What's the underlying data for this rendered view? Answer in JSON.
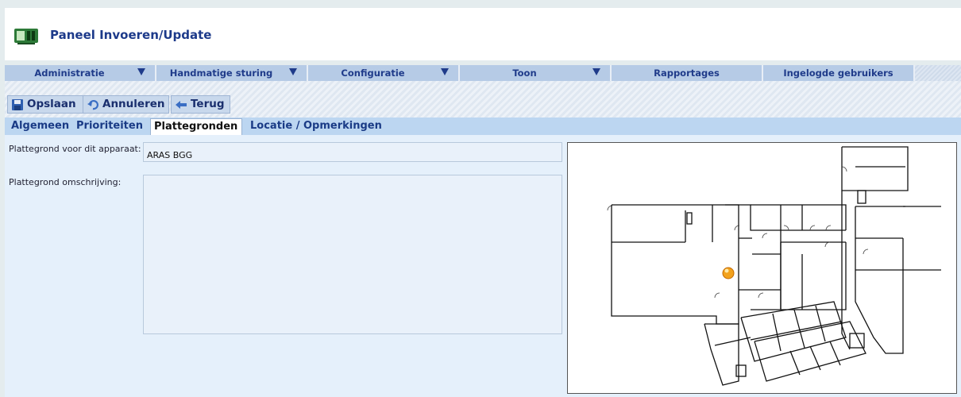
{
  "app": {
    "title": "Paneel Invoeren/Update",
    "logo_icon": "panel-icon"
  },
  "nav": {
    "items": [
      {
        "label": "Administratie",
        "has_dropdown": true
      },
      {
        "label": "Handmatige sturing",
        "has_dropdown": true
      },
      {
        "label": "Configuratie",
        "has_dropdown": true
      },
      {
        "label": "Toon",
        "has_dropdown": true
      },
      {
        "label": "Rapportages",
        "has_dropdown": false
      },
      {
        "label": "Ingelogde gebruikers",
        "has_dropdown": false
      }
    ]
  },
  "toolbar": {
    "save_label": "Opslaan",
    "cancel_label": "Annuleren",
    "back_label": "Terug"
  },
  "tabs": [
    {
      "label": "Algemeen",
      "active": false
    },
    {
      "label": "Prioriteiten",
      "active": false
    },
    {
      "label": "Plattegronden",
      "active": true
    },
    {
      "label": "Locatie / Opmerkingen",
      "active": false
    }
  ],
  "form": {
    "floorplan_label": "Plattegrond voor dit apparaat:",
    "floorplan_value": "ARAS BGG",
    "description_label": "Plattegrond omschrijving:",
    "description_value": ""
  },
  "colors": {
    "accent": "#1d3a8a",
    "nav_bg": "#b6cbe6",
    "tab_bar_bg": "#bcd6f1",
    "content_bg": "#e5f0fb"
  }
}
